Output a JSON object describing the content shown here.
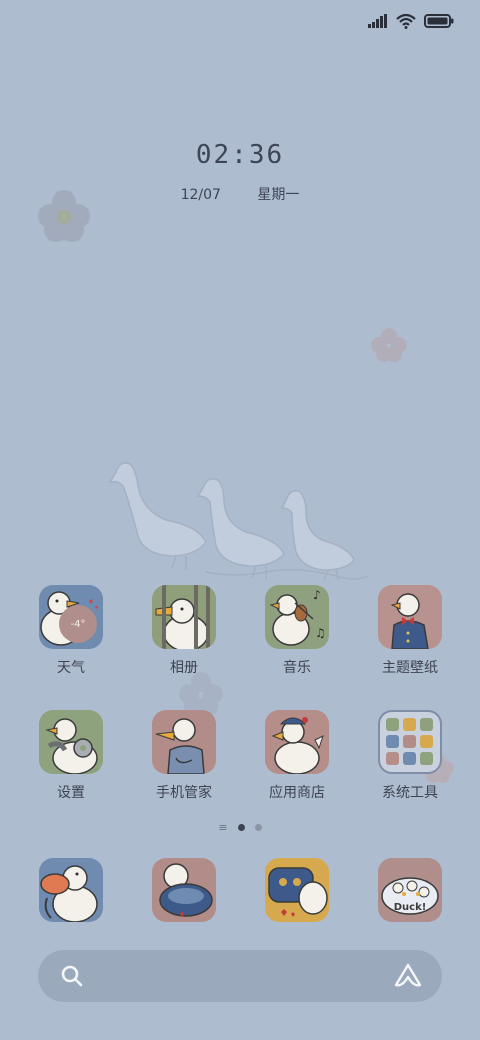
{
  "status": {
    "signal_icon": "signal-icon",
    "wifi_icon": "wifi-icon",
    "battery_icon": "battery-icon"
  },
  "lock": {
    "time": "02:36",
    "date": "12/07",
    "weekday": "星期一"
  },
  "apps_row1": [
    {
      "label": "天气",
      "icon": "duck-weather-icon",
      "badge": "-4°",
      "bg": "#6f8bb0"
    },
    {
      "label": "相册",
      "icon": "duck-gallery-icon",
      "bg": "#8f9f7a"
    },
    {
      "label": "音乐",
      "icon": "duck-music-icon",
      "bg": "#8fa07f"
    },
    {
      "label": "主题壁纸",
      "icon": "duck-theme-icon",
      "bg": "#b8928e"
    }
  ],
  "apps_row2": [
    {
      "label": "设置",
      "icon": "duck-settings-icon",
      "bg": "#8ea27d"
    },
    {
      "label": "手机管家",
      "icon": "duck-manager-icon",
      "bg": "#b28c88"
    },
    {
      "label": "应用商店",
      "icon": "duck-store-icon",
      "bg": "#b58e8a"
    },
    {
      "label": "系统工具",
      "icon": "folder-system-tools-icon",
      "bg": "#c9d1df"
    }
  ],
  "dock": [
    {
      "icon": "duck-phone-icon",
      "bg": "#6f8bb0"
    },
    {
      "icon": "duck-messages-icon",
      "bg": "#b28c88"
    },
    {
      "icon": "duck-browser-icon",
      "bg": "#d7a94f"
    },
    {
      "icon": "duck-camera-icon",
      "bg": "#b08e8c",
      "text": "Duck!"
    }
  ],
  "page_indicator": {
    "pages": 2,
    "active": 0
  },
  "search": {
    "search_icon": "search-icon",
    "assistant_icon": "assistant-icon"
  }
}
